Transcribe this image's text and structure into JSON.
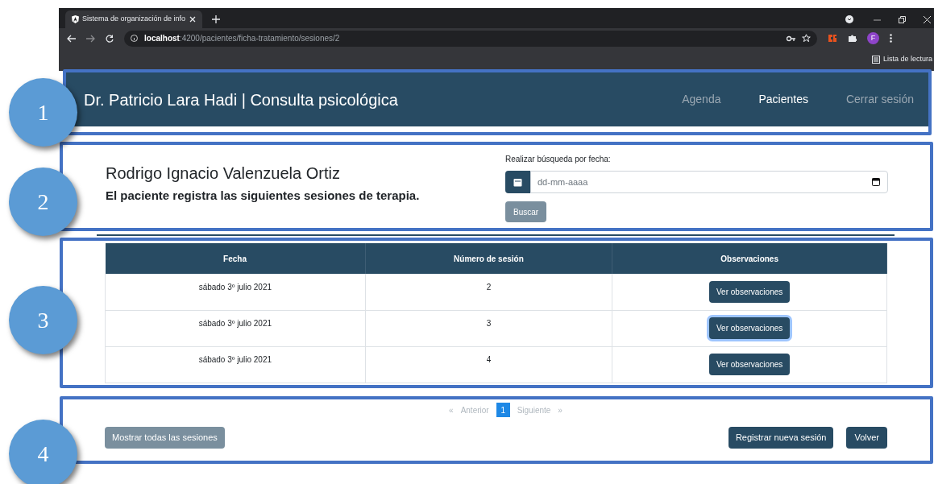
{
  "browser": {
    "tab_title": "Sistema de organización de info",
    "url_host": "localhost",
    "url_path": ":4200/pacientes/ficha-tratamiento/sesiones/2",
    "profile": "F",
    "bookmark": "Lista de lectura"
  },
  "navbar": {
    "brand": "Dr. Patricio Lara Hadi | Consulta psicológica",
    "links": [
      {
        "label": "Agenda",
        "selected": false
      },
      {
        "label": "Pacientes",
        "selected": true
      },
      {
        "label": "Cerrar sesión",
        "selected": false
      }
    ]
  },
  "patient": {
    "name": "Rodrigo Ignacio Valenzuela Ortiz",
    "subtitle": "El paciente registra las siguientes sesiones de terapia."
  },
  "search": {
    "label": "Realizar búsqueda por fecha:",
    "placeholder": "dd-mm-aaaa",
    "button": "Buscar"
  },
  "table": {
    "columns": [
      "Fecha",
      "Número de sesión",
      "Observaciones"
    ],
    "rows": [
      {
        "date": "sábado 3º julio 2021",
        "session": "2",
        "action": "Ver observaciones",
        "focused": false
      },
      {
        "date": "sábado 3º julio 2021",
        "session": "3",
        "action": "Ver observaciones",
        "focused": true
      },
      {
        "date": "sábado 3º julio 2021",
        "session": "4",
        "action": "Ver observaciones",
        "focused": false
      }
    ]
  },
  "pagination": {
    "first": "«",
    "prev": "Anterior",
    "pages": [
      {
        "label": "1",
        "selected": true
      }
    ],
    "next": "Siguiente",
    "last": "»"
  },
  "buttons": {
    "show_all": "Mostrar todas las sesiones",
    "new_session": "Registrar nueva sesión",
    "back": "Volver"
  },
  "annotations": [
    "1",
    "2",
    "3",
    "4"
  ]
}
